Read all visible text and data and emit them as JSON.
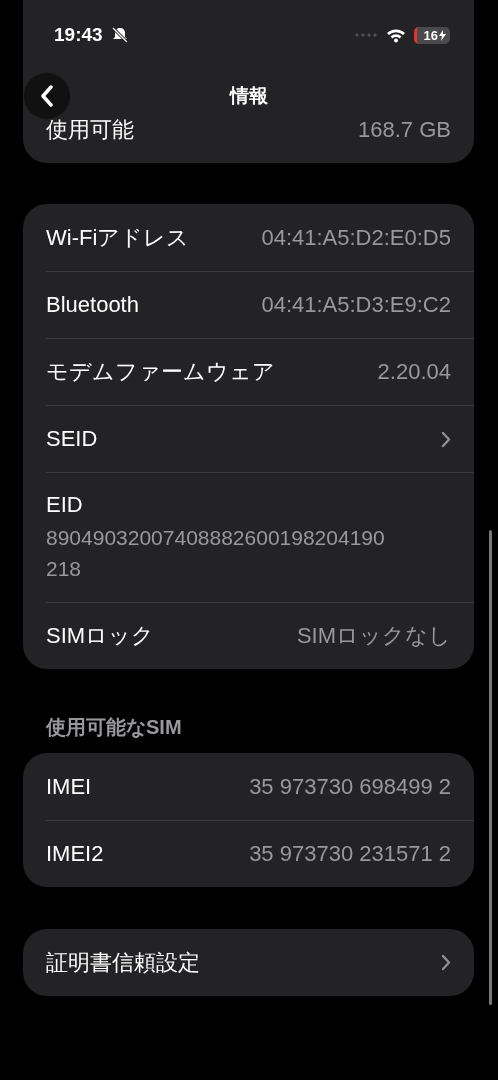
{
  "status_bar": {
    "time": "19:43",
    "silent": true,
    "battery": "16"
  },
  "nav": {
    "title": "情報"
  },
  "storage": [
    {
      "label": "使用可能",
      "value": "168.7 GB"
    }
  ],
  "network": [
    {
      "kind": "value",
      "label": "Wi-Fiアドレス",
      "value": "04:41:A5:D2:E0:D5"
    },
    {
      "kind": "value",
      "label": "Bluetooth",
      "value": "04:41:A5:D3:E9:C2"
    },
    {
      "kind": "value",
      "label": "モデムファームウェア",
      "value": "2.20.04"
    },
    {
      "kind": "link",
      "label": "SEID"
    },
    {
      "kind": "stacked",
      "label": "EID",
      "value": "89049032007408882600198204190218"
    },
    {
      "kind": "value",
      "label": "SIMロック",
      "value": "SIMロックなし"
    }
  ],
  "sim_section": {
    "header": "使用可能なSIM",
    "rows": [
      {
        "kind": "value",
        "label": "IMEI",
        "value": "35 973730 698499 2"
      },
      {
        "kind": "value",
        "label": "IMEI2",
        "value": "35 973730 231571 2"
      }
    ]
  },
  "certificates": [
    {
      "kind": "link",
      "label": "証明書信頼設定"
    }
  ]
}
